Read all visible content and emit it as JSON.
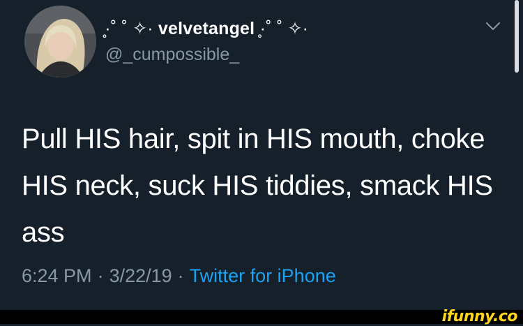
{
  "tweet": {
    "display_name_prefix": "̥·˚ ˚ ✧·",
    "display_name": "velvetangel",
    "display_name_suffix": "̥·˚ ˚ ✧·",
    "handle": "@_cumpossible_",
    "text": "Pull HIS hair, spit in HIS mouth, choke HIS neck, suck HIS tiddies, smack HIS ass",
    "time": "6:24 PM",
    "date": "3/22/19",
    "separator": "·",
    "source": "Twitter for iPhone"
  },
  "icons": {
    "menu": "chevron-down-icon",
    "avatar": "avatar"
  },
  "footer": {
    "watermark": "ifunny.co"
  },
  "colors": {
    "background": "#15202b",
    "primary_text": "#ffffff",
    "secondary_text": "#8899a6",
    "link": "#1da1f2",
    "watermark": "#ffd41c"
  }
}
